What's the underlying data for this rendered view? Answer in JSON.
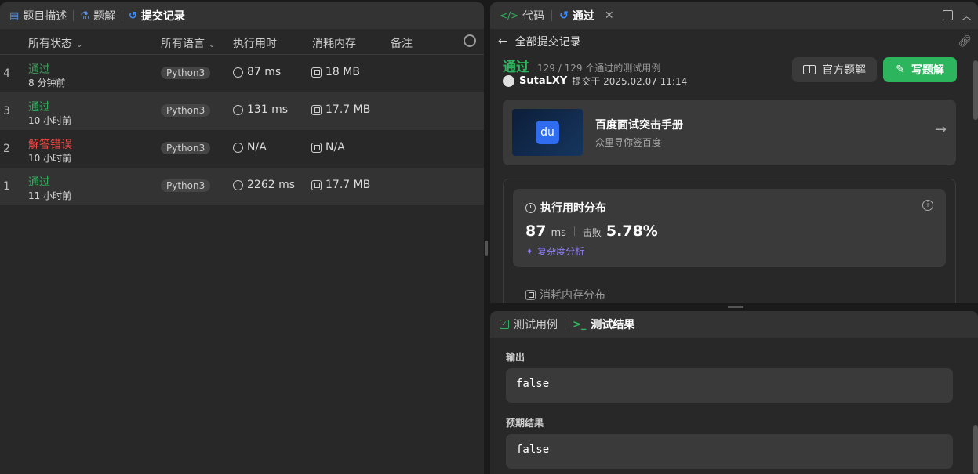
{
  "left_tabs": {
    "description": "题目描述",
    "solution": "题解",
    "submissions": "提交记录"
  },
  "table_head": {
    "status": "所有状态",
    "language": "所有语言",
    "runtime": "执行用时",
    "memory": "消耗内存",
    "note": "备注"
  },
  "submissions": [
    {
      "num": "4",
      "status": "通过",
      "ago": "8 分钟前",
      "lang": "Python3",
      "runtime": "87 ms",
      "memory": "18 MB"
    },
    {
      "num": "3",
      "status": "通过",
      "ago": "10 小时前",
      "lang": "Python3",
      "runtime": "131 ms",
      "memory": "17.7 MB"
    },
    {
      "num": "2",
      "status": "解答错误",
      "ago": "10 小时前",
      "lang": "Python3",
      "runtime": "N/A",
      "memory": "N/A"
    },
    {
      "num": "1",
      "status": "通过",
      "ago": "11 小时前",
      "lang": "Python3",
      "runtime": "2262 ms",
      "memory": "17.7 MB"
    }
  ],
  "right_tabs": {
    "code": "代码",
    "result": "通过"
  },
  "subhead": {
    "back_label": "全部提交记录"
  },
  "result": {
    "status": "通过",
    "count": "129 / 129 个通过的测试用例",
    "username": "SutaLXY",
    "submitted": "提交于 2025.02.07 11:14",
    "official_btn": "官方题解",
    "write_btn": "写题解"
  },
  "promo": {
    "title": "百度面试突击手册",
    "subtitle": "众里寻你签百度"
  },
  "distribution": {
    "title": "执行用时分布",
    "value": "87",
    "unit": "ms",
    "beat_label": "击败",
    "beat_value": "5.78%",
    "complexity": "复杂度分析",
    "memory_title": "消耗内存分布"
  },
  "bottom_tabs": {
    "testcase": "测试用例",
    "testresult": "测试结果"
  },
  "bottom": {
    "output_label": "输出",
    "output_value": "false",
    "expected_label": "预期结果",
    "expected_value": "false"
  },
  "colors": {
    "accent_green": "#2db55d",
    "error_red": "#ef4743",
    "accent_blue": "#3e8fff"
  }
}
